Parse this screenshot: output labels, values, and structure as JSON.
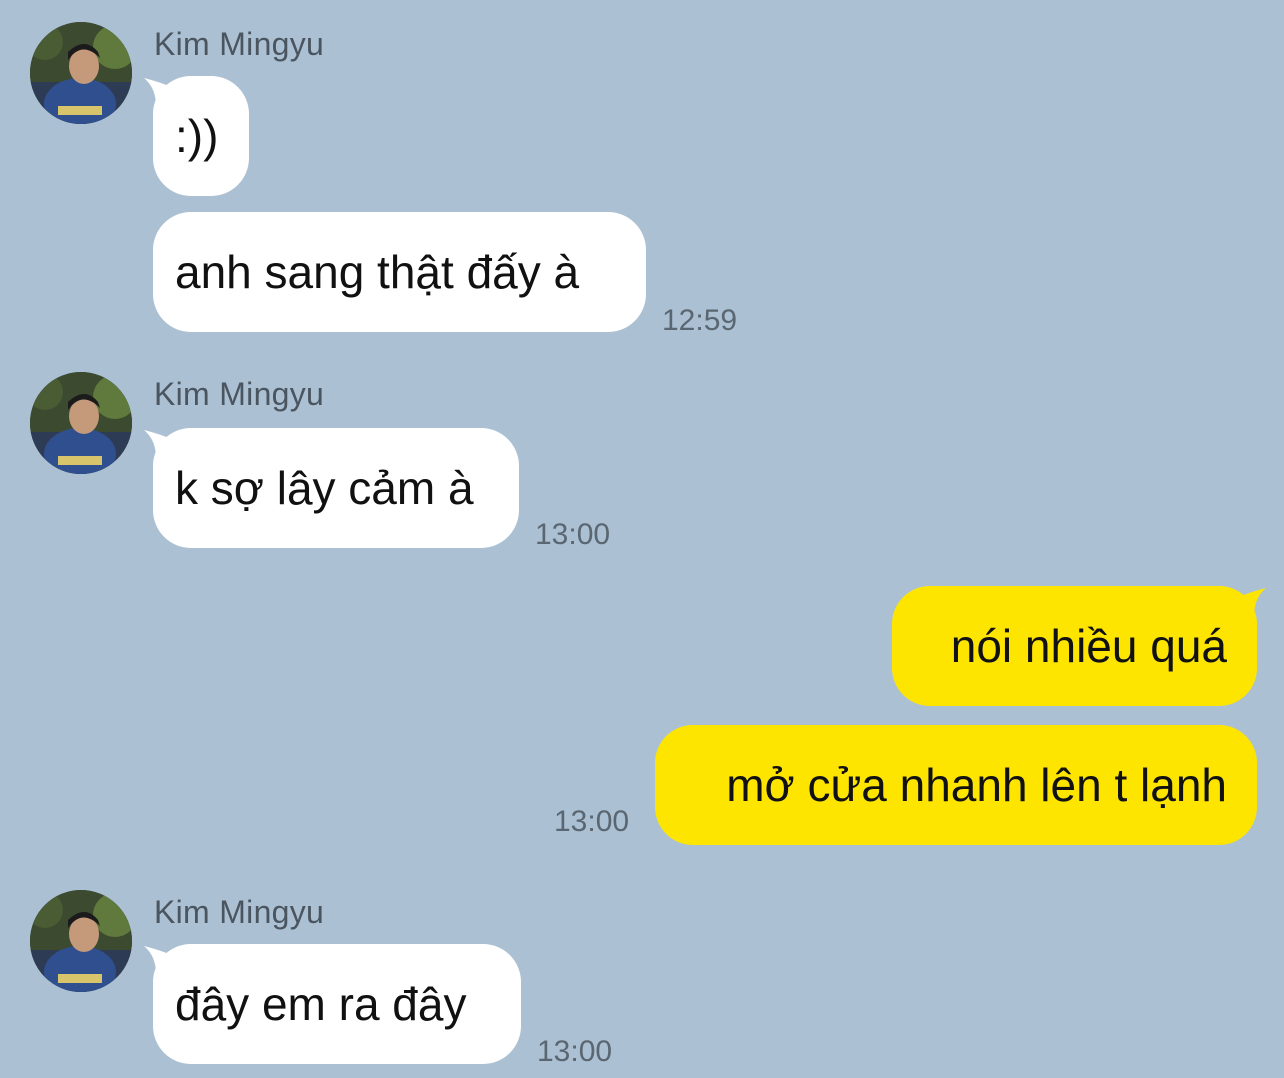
{
  "colors": {
    "background": "#abc1d3",
    "incoming_bubble": "#ffffff",
    "outgoing_bubble": "#fee500",
    "name_text": "#4b5560",
    "time_text": "#5a6672"
  },
  "messages": [
    {
      "direction": "incoming",
      "sender": "Kim Mingyu",
      "avatar_icon": "profile-photo",
      "bubbles": [
        ":))",
        "anh sang thật đấy à"
      ],
      "time": "12:59"
    },
    {
      "direction": "incoming",
      "sender": "Kim Mingyu",
      "avatar_icon": "profile-photo",
      "bubbles": [
        "k sợ lây cảm à"
      ],
      "time": "13:00"
    },
    {
      "direction": "outgoing",
      "bubbles": [
        "nói nhiều quá",
        "mở cửa nhanh lên t lạnh"
      ],
      "time": "13:00"
    },
    {
      "direction": "incoming",
      "sender": "Kim Mingyu",
      "avatar_icon": "profile-photo",
      "bubbles": [
        "đây em ra đây"
      ],
      "time": "13:00"
    }
  ]
}
